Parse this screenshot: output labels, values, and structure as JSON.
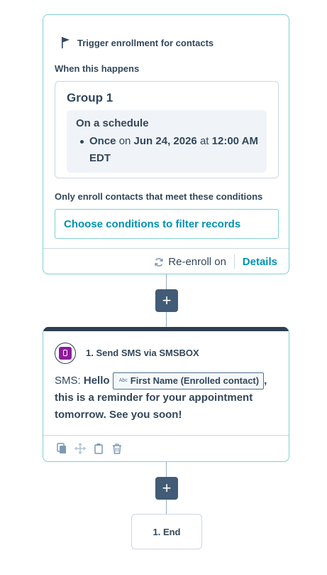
{
  "trigger": {
    "title": "Trigger enrollment for contacts",
    "when_label": "When this happens",
    "group_title": "Group 1",
    "schedule_title": "On a schedule",
    "schedule": {
      "frequency": "Once",
      "on_text": "on",
      "date": "Jun 24, 2026",
      "at_text": "at",
      "time": "12:00 AM EDT"
    },
    "only_enroll_label": "Only enroll contacts that meet these conditions",
    "filter_button": "Choose conditions to filter records",
    "reenroll_label": "Re-enroll on",
    "details_link": "Details"
  },
  "add_step_1": "+",
  "action": {
    "title": "1. Send SMS via SMSBOX",
    "sms_prefix": "SMS:",
    "sms_hello": "Hello",
    "token_label": "First Name (Enrolled contact)",
    "token_type": "Abc",
    "sms_comma": ",",
    "sms_rest": "this is a reminder for your appointment tomorrow. See you soon!"
  },
  "add_step_2": "+",
  "end_label": "1. End",
  "colors": {
    "accent_teal": "#0091ae",
    "card_border": "#7fd1d1",
    "dark_navy": "#2d3e50",
    "plus_button": "#425b76",
    "sms_brand": "#8e1b9c"
  }
}
